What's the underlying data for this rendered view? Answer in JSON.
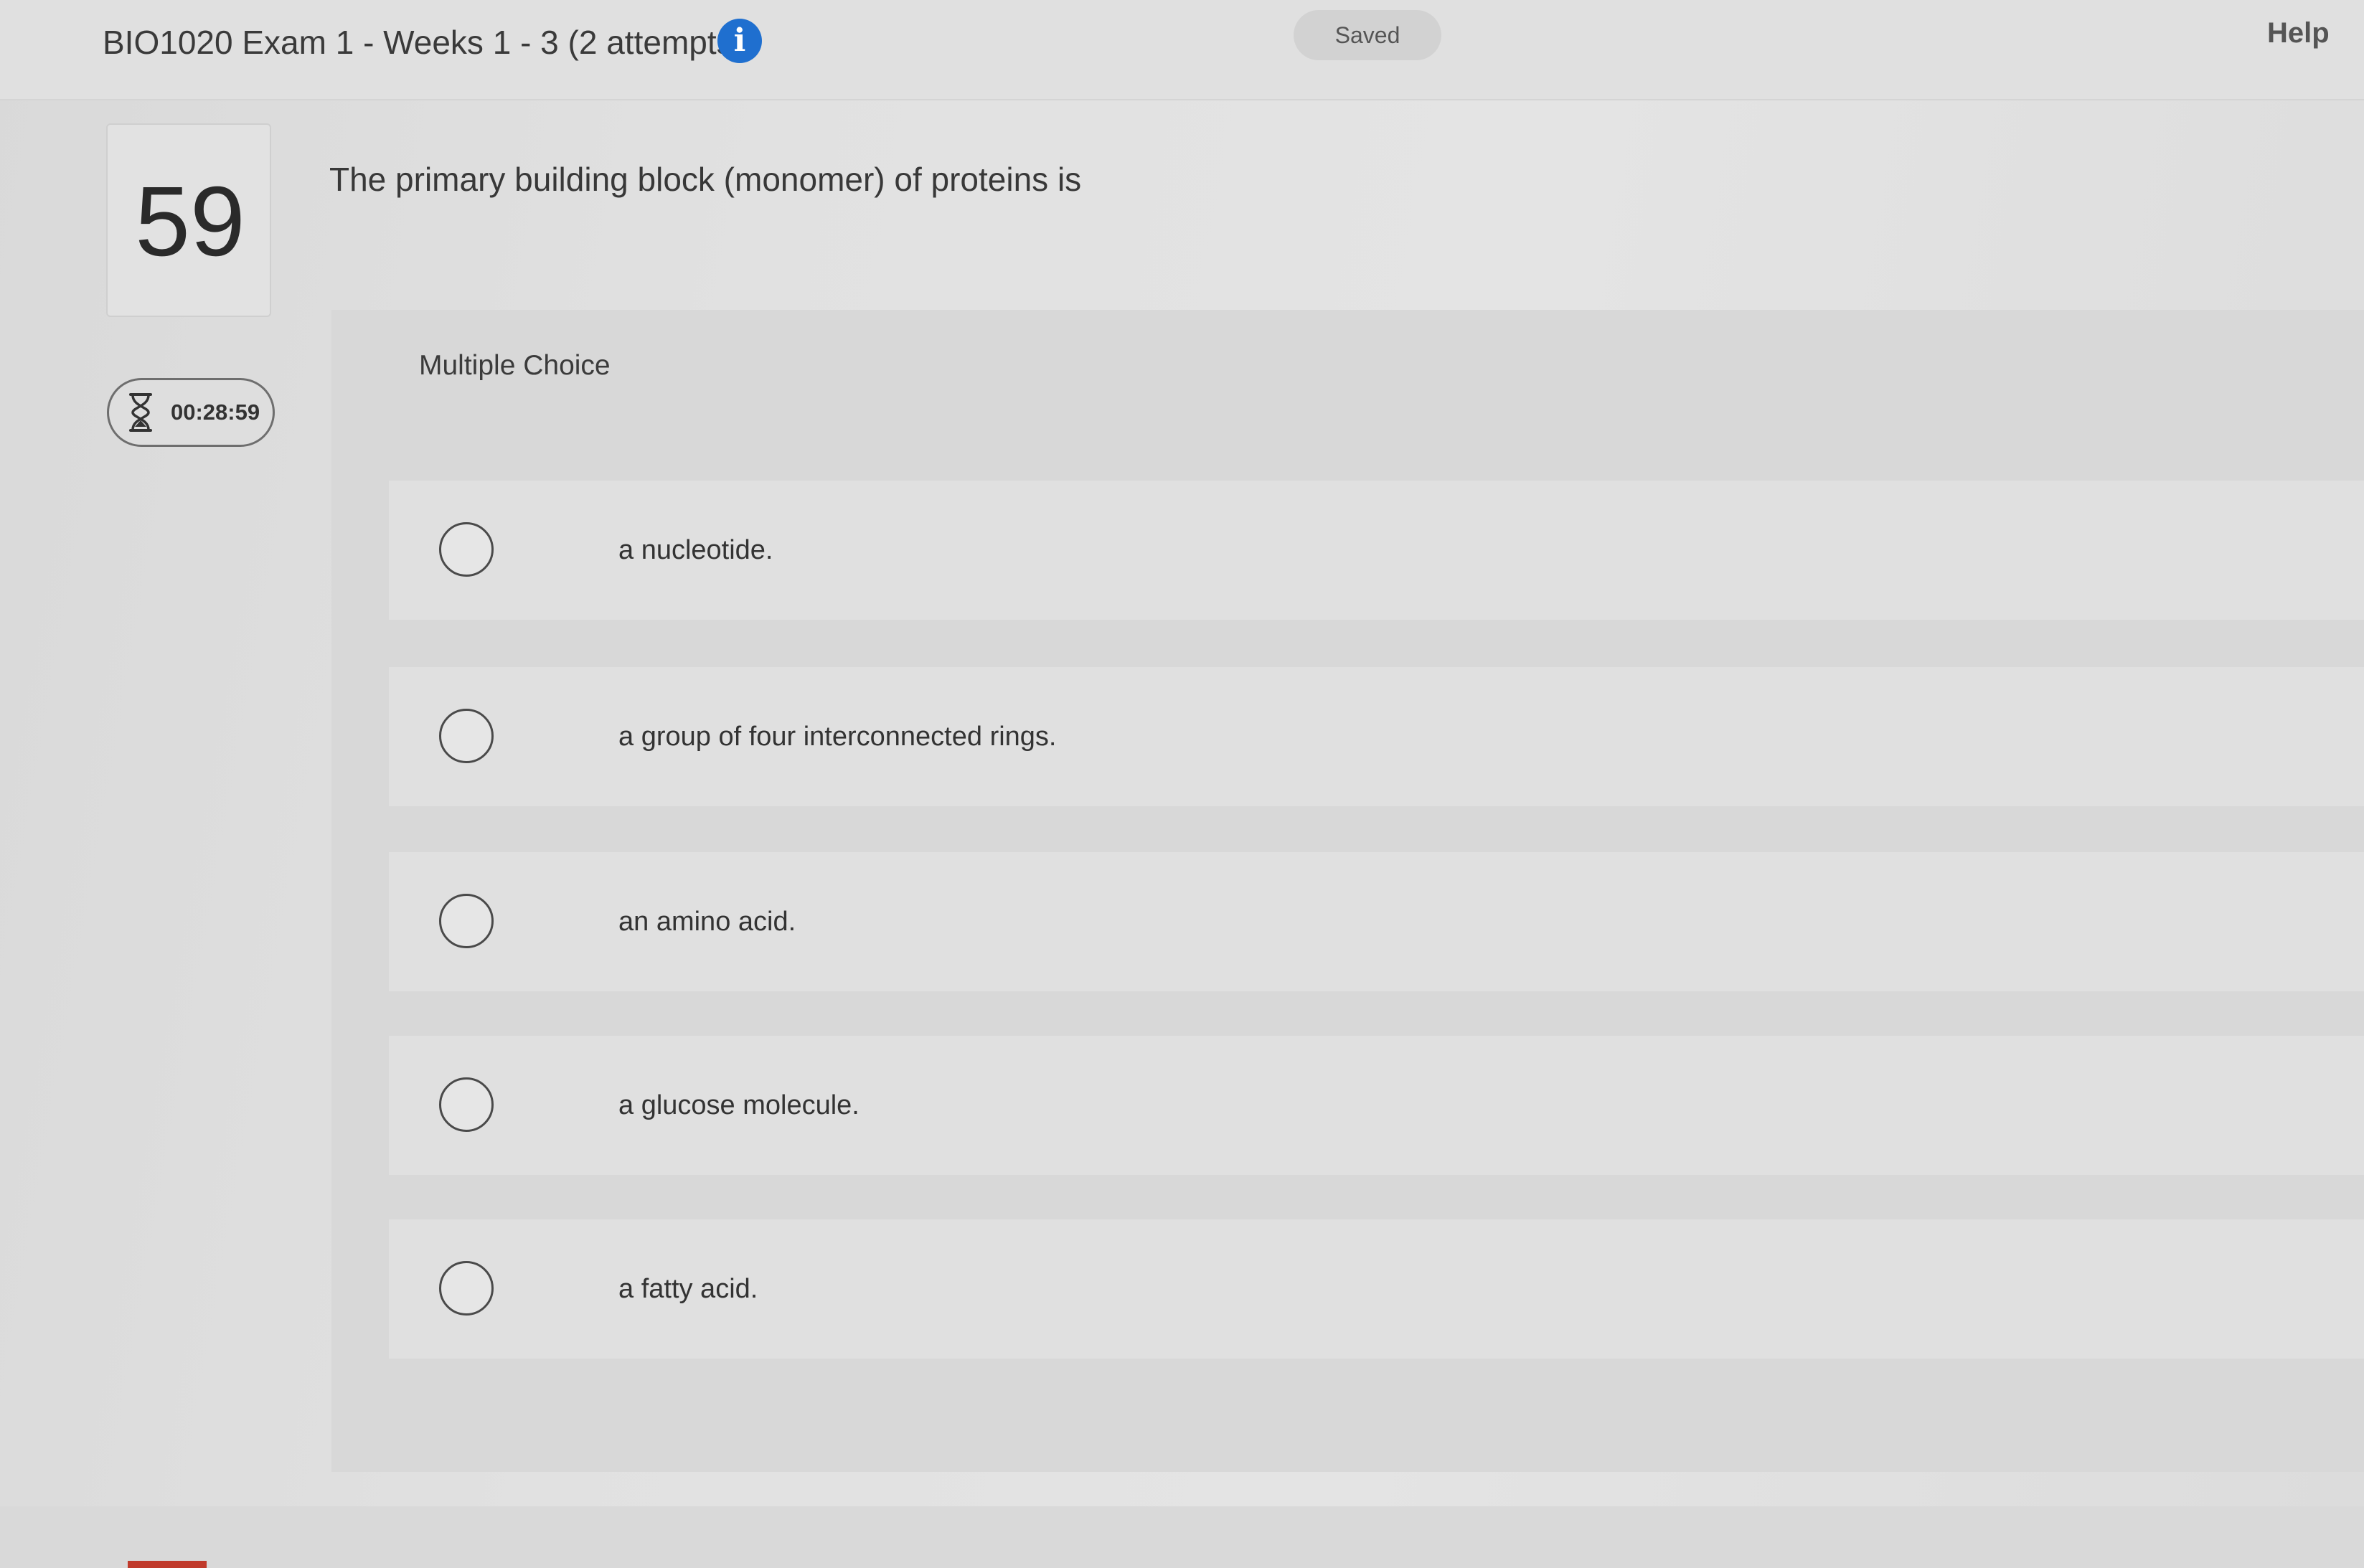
{
  "header": {
    "exam_title": "BIO1020 Exam 1 - Weeks 1 - 3 (2 attempts)",
    "info_icon": "info-icon",
    "saved_label": "Saved",
    "help_label": "Help"
  },
  "question": {
    "number": "59",
    "prompt": "The primary building block (monomer) of proteins is",
    "type_label": "Multiple Choice",
    "options": [
      {
        "label": "a nucleotide."
      },
      {
        "label": "a group of four interconnected rings."
      },
      {
        "label": "an amino acid."
      },
      {
        "label": "a glucose molecule."
      },
      {
        "label": "a fatty acid."
      }
    ]
  },
  "timer": {
    "icon": "hourglass-icon",
    "remaining": "00:28:59"
  },
  "colors": {
    "info_blue": "#1f6fcf",
    "accent_red": "#c03a2b"
  }
}
